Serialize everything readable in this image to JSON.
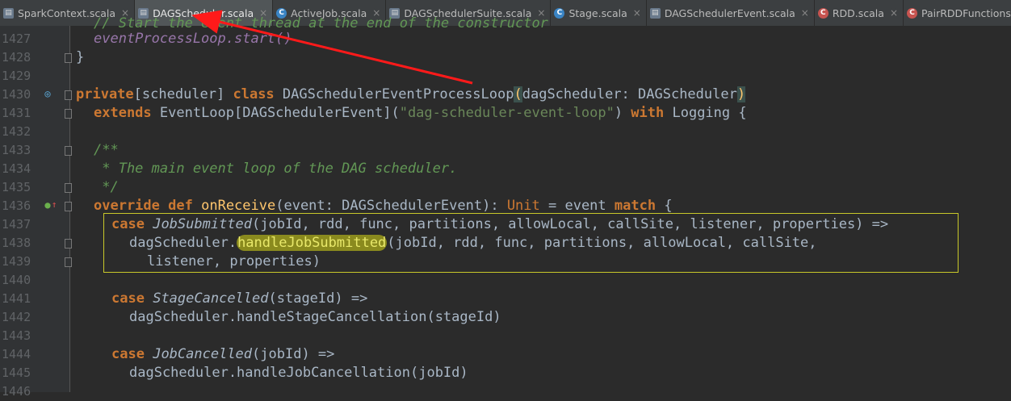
{
  "tabs": [
    {
      "label": "SparkContext.scala",
      "icon": "scala-file-icon",
      "active": false
    },
    {
      "label": "DAGScheduler.scala",
      "icon": "scala-file-icon",
      "active": true
    },
    {
      "label": "ActiveJob.scala",
      "icon": "scala-class-icon",
      "active": false
    },
    {
      "label": "DAGSchedulerSuite.scala",
      "icon": "scala-file-icon",
      "active": false
    },
    {
      "label": "Stage.scala",
      "icon": "scala-class-icon",
      "active": false
    },
    {
      "label": "DAGSchedulerEvent.scala",
      "icon": "scala-file-icon",
      "active": false
    },
    {
      "label": "RDD.scala",
      "icon": "scala-class-icon",
      "active": false
    },
    {
      "label": "PairRDDFunctions.scala",
      "icon": "scala-class-icon",
      "active": false
    }
  ],
  "editor": {
    "line_numbers": [
      "1427",
      "1428",
      "1429",
      "1430",
      "1431",
      "1432",
      "1433",
      "1434",
      "1435",
      "1436",
      "1437",
      "1438",
      "1439",
      "1440",
      "1441",
      "1442",
      "1443",
      "1444",
      "1445",
      "1446"
    ],
    "top_partial_line": "// Start the event thread at the end of the constructor",
    "lines": {
      "l1427": "eventProcessLoop.start()",
      "l1428": "}",
      "l1430_kw1": "private",
      "l1430_mod": "[scheduler] ",
      "l1430_kw2": "class",
      "l1430_name": " DAGSchedulerEventProcessLoop",
      "l1430_paren_open": "(",
      "l1430_params": "dagScheduler: DAGScheduler",
      "l1430_paren_close": ")",
      "l1431_kw": "extends",
      "l1431_a": " EventLoop[DAGSchedulerEvent](",
      "l1431_str": "\"dag-scheduler-event-loop\"",
      "l1431_b": ") ",
      "l1431_kw2": "with",
      "l1431_c": " Logging {",
      "l1433": "/**",
      "l1434": " * The main event loop of the DAG scheduler.",
      "l1435": " */",
      "l1436_kw1": "override",
      "l1436_kw2": "def",
      "l1436_fn": "onReceive",
      "l1436_a": "(event: DAGSchedulerEvent): ",
      "l1436_unit": "Unit",
      "l1436_b": " = event ",
      "l1436_kw3": "match",
      "l1436_c": " {",
      "l1437_kw": "case",
      "l1437_obj": "JobSubmitted",
      "l1437_args": "(jobId, rdd, func, partitions, allowLocal, callSite, listener, properties) =>",
      "l1438_a": "dagScheduler.",
      "l1438_hl": "handleJobSubmitted",
      "l1438_b": "(jobId, rdd, func, partitions, allowLocal, callSite,",
      "l1439": "listener, properties)",
      "l1441_kw": "case",
      "l1441_obj": "StageCancelled",
      "l1441_args": "(stageId) =>",
      "l1442": "dagScheduler.handleStageCancellation(stageId)",
      "l1444_kw": "case",
      "l1444_obj": "JobCancelled",
      "l1444_args": "(jobId) =>",
      "l1445": "dagScheduler.handleJobCancellation(jobId)"
    }
  },
  "annotation": {
    "type": "red-arrow",
    "color": "#ff1a1a",
    "points_to": "DAGScheduler.scala tab"
  },
  "colors": {
    "keyword": "#cc7832",
    "string": "#6a8759",
    "comment": "#629755",
    "object": "#9876aa",
    "function": "#ffc66d",
    "highlight_box": "#c8c82a"
  }
}
